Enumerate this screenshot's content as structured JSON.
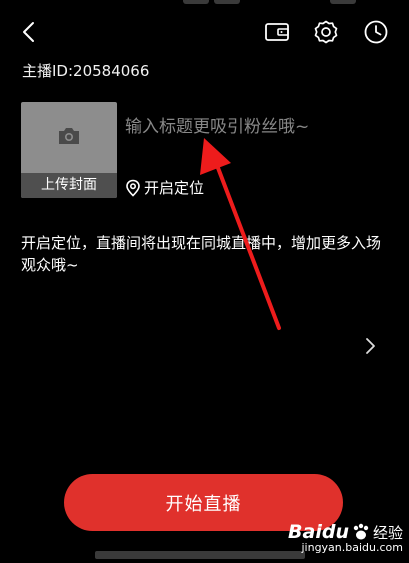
{
  "header": {
    "back_icon": "chevron-left-icon",
    "wallet_icon": "wallet-icon",
    "settings_icon": "gear-icon",
    "history_icon": "clock-icon"
  },
  "host_id": "主播ID:20584066",
  "cover": {
    "icon": "camera-icon",
    "label": "上传封面"
  },
  "title_input": {
    "placeholder": "输入标题更吸引粉丝哦~"
  },
  "location": {
    "icon": "location-pin-icon",
    "label": "开启定位"
  },
  "info_text": "开启定位，直播间将出现在同城直播中，增加更多入场观众哦~",
  "start_button": {
    "label": "开始直播",
    "color": "#e0312c"
  },
  "annotation": {
    "arrow_color": "#ee1c1c"
  },
  "watermark": {
    "brand": "Baidu",
    "brand_cn": "经验",
    "url": "jingyan.baidu.com"
  }
}
